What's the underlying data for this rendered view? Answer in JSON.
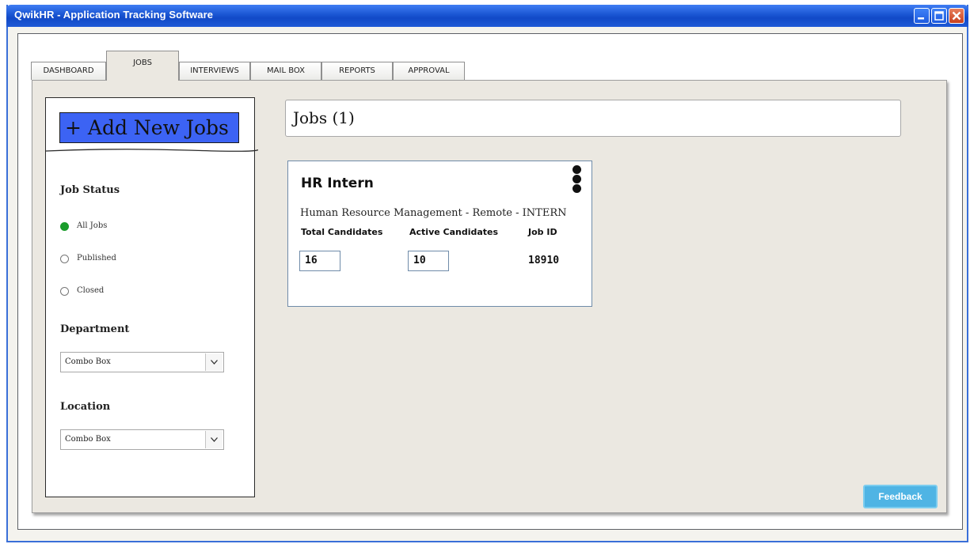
{
  "window": {
    "title": "QwikHR - Application Tracking Software"
  },
  "tabs": [
    {
      "label": "DASHBOARD",
      "active": false
    },
    {
      "label": "JOBS",
      "active": true
    },
    {
      "label": "INTERVIEWS",
      "active": false
    },
    {
      "label": "MAIL BOX",
      "active": false
    },
    {
      "label": "REPORTS",
      "active": false
    },
    {
      "label": "APPROVAL",
      "active": false
    }
  ],
  "sidebar": {
    "add_button_label": "+ Add New Jobs",
    "job_status": {
      "heading": "Job Status",
      "options": [
        {
          "label": "All Jobs",
          "selected": true
        },
        {
          "label": "Published",
          "selected": false
        },
        {
          "label": "Closed",
          "selected": false
        }
      ]
    },
    "department": {
      "heading": "Department",
      "value": "Combo Box"
    },
    "location": {
      "heading": "Location",
      "value": "Combo Box"
    }
  },
  "main": {
    "header": "Jobs (1)",
    "jobs": [
      {
        "title": "HR Intern",
        "subtitle": "Human Resource Management - Remote - INTERN",
        "total_candidates_label": "Total Candidates",
        "total_candidates": "16",
        "active_candidates_label": "Active Candidates",
        "active_candidates": "10",
        "job_id_label": "Job ID",
        "job_id": "18910"
      }
    ]
  },
  "feedback_label": "Feedback",
  "colors": {
    "titlebar": "#1a55d2",
    "add_button": "#3c63f4",
    "selected_radio": "#1a9c2b",
    "feedback": "#4fb4e4",
    "panel_bg": "#ebe8e1"
  }
}
